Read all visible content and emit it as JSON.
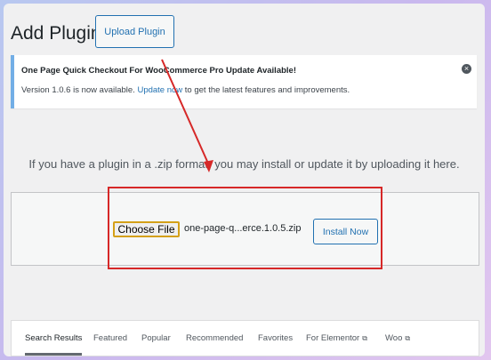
{
  "page": {
    "title": "Add Plugins",
    "upload_button": "Upload Plugin"
  },
  "notice": {
    "title": "One Page Quick Checkout For WooCommerce Pro Update Available!",
    "body_prefix": "Version 1.0.6 is now available. ",
    "link_text": "Update now",
    "body_suffix": " to get the latest features and improvements.",
    "dismiss_icon": "×"
  },
  "upload": {
    "help_text": "If you have a plugin in a .zip format, you may install or update it by uploading it here.",
    "choose_file_label": "Choose File",
    "file_name": "one-page-q...erce.1.0.5.zip",
    "install_label": "Install Now"
  },
  "tabs": [
    {
      "label": "Search Results",
      "active": true
    },
    {
      "label": "Featured"
    },
    {
      "label": "Popular"
    },
    {
      "label": "Recommended"
    },
    {
      "label": "Favorites"
    },
    {
      "label": "For Elementor",
      "external": true
    },
    {
      "label": "Woo",
      "external": true
    }
  ],
  "colors": {
    "accent": "#2271b1",
    "annotation": "#d62828",
    "notice_border": "#72aee6"
  },
  "icons": {
    "external_link": "⧉"
  }
}
